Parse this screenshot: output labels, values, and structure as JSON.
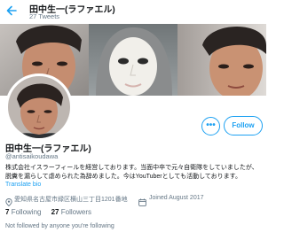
{
  "header": {
    "title": "田中生一(ラファエル)",
    "tweets": "27 Tweets",
    "back_icon": "arrow-left-icon"
  },
  "colors": {
    "accent": "#1da1f2",
    "text": "#14171a",
    "muted": "#657786"
  },
  "profile": {
    "name": "田中生一(ラファエル)",
    "handle": "@antisaikoudawa",
    "bio_line1": "株式会社イスラーフィールを経営しております。当面中卒で元々自衛隊をしていましたが、",
    "bio_line2": "脱糞を漏らして虐められた為辞めました。今はYouTuberとしても活動しております。",
    "translate": "Translate bio",
    "location": "愛知県名古屋市緑区横山三丁目1201番地",
    "joined": "Joined August 2017",
    "following_count": "7",
    "following_label": "Following",
    "followers_count": "27",
    "followers_label": "Followers",
    "not_followed": "Not followed by anyone you're following"
  },
  "actions": {
    "more": "•••",
    "follow": "Follow"
  }
}
